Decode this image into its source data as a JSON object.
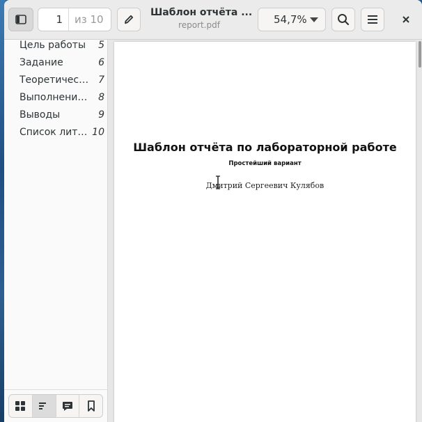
{
  "header": {
    "page_number": "1",
    "page_total": "из 10",
    "title": "Шаблон отчёта ...",
    "filename": "report.pdf",
    "zoom": "54,7%"
  },
  "outline": [
    {
      "label": "Цель работы",
      "page": "5"
    },
    {
      "label": "Задание",
      "page": "6"
    },
    {
      "label": "Теоретичес…",
      "page": "7"
    },
    {
      "label": "Выполнение…",
      "page": "8"
    },
    {
      "label": "Выводы",
      "page": "9"
    },
    {
      "label": "Список лите…",
      "page": "10"
    }
  ],
  "document": {
    "title": "Шаблон отчёта по лабораторной работе",
    "subtitle": "Простейший вариант",
    "author": "Дмитрий Сергеевич Кулябов"
  }
}
